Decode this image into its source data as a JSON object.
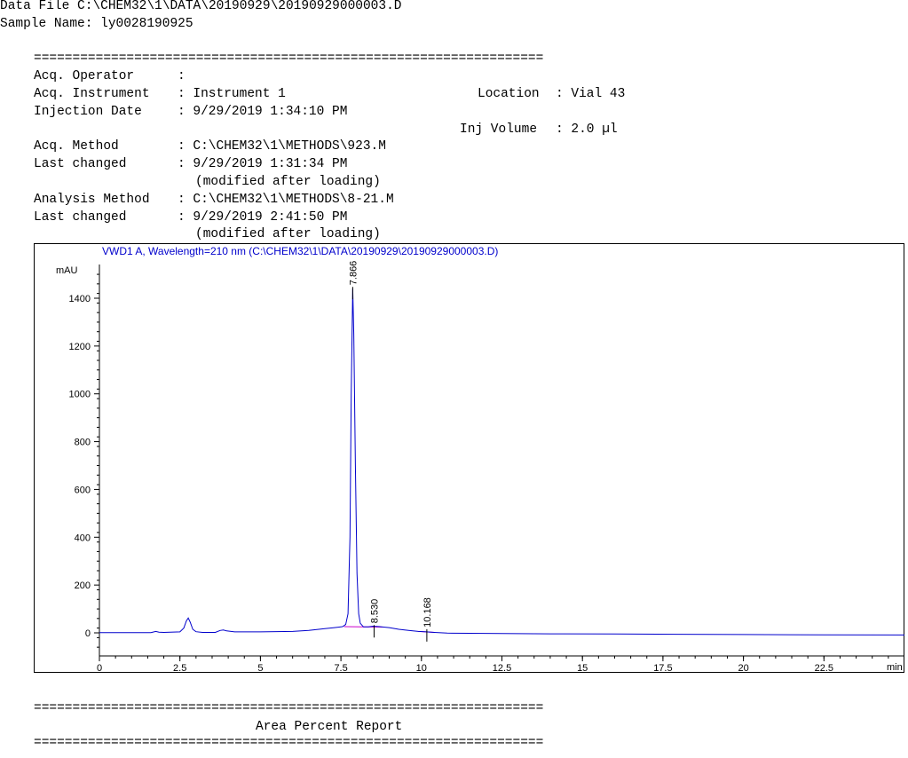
{
  "header": {
    "data_file_label": "Data File",
    "data_file_path": "C:\\CHEM32\\1\\DATA\\20190929\\20190929000003.D",
    "sample_name_label": "Sample Name:",
    "sample_name": "ly0028190925"
  },
  "separator": "==================================================================",
  "info": {
    "acq_operator_label": "Acq. Operator",
    "acq_operator_value": ":",
    "acq_instrument_label": "Acq. Instrument",
    "acq_instrument_value": ": Instrument 1",
    "location_label": "Location",
    "location_value": ": Vial 43",
    "injection_date_label": "Injection Date",
    "injection_date_value": ": 9/29/2019 1:34:10 PM",
    "inj_volume_label": "Inj Volume",
    "inj_volume_value": ": 2.0 µl",
    "acq_method_label": "Acq. Method",
    "acq_method_value": ": C:\\CHEM32\\1\\METHODS\\923.M",
    "last_changed_1_label": "Last changed",
    "last_changed_1_value": ": 9/29/2019 1:31:34 PM",
    "modified_1": "(modified after loading)",
    "analysis_method_label": "Analysis Method",
    "analysis_method_value": ": C:\\CHEM32\\1\\METHODS\\8-21.M",
    "last_changed_2_label": "Last changed",
    "last_changed_2_value": ": 9/29/2019 2:41:50 PM",
    "modified_2": "(modified after loading)"
  },
  "report_title": "Area Percent Report",
  "chart_data": {
    "type": "line",
    "title": "VWD1 A, Wavelength=210 nm (C:\\CHEM32\\1\\DATA\\20190929\\20190929000003.D)",
    "ylabel": "mAU",
    "xlabel": "min",
    "xlim": [
      0,
      25
    ],
    "ylim": [
      -150,
      1530
    ],
    "x_ticks": [
      0,
      2.5,
      5,
      7.5,
      10,
      12.5,
      15,
      17.5,
      20,
      22.5
    ],
    "x_tick_labels": [
      "0",
      "2.5",
      "5",
      "7.5",
      "10",
      "12.5",
      "15",
      "17.5",
      "20",
      "22.5"
    ],
    "y_ticks": [
      0,
      200,
      400,
      600,
      800,
      1000,
      1200,
      1400
    ],
    "y_tick_labels": [
      "0",
      "200",
      "400",
      "600",
      "800",
      "1000",
      "1200",
      "1400"
    ],
    "grid": false,
    "line_color": "#0000cc",
    "baseline_color": "#cc00cc",
    "peak_labels": [
      {
        "x": 7.866,
        "label": "7.866",
        "y": 1440
      },
      {
        "x": 8.53,
        "label": "8.530",
        "y": 25
      },
      {
        "x": 10.168,
        "label": "10.168",
        "y": 8
      }
    ],
    "series": [
      {
        "x": [
          0,
          1.6,
          1.75,
          1.85,
          2.0,
          2.5,
          2.62,
          2.7,
          2.76,
          2.82,
          2.9,
          3.0,
          3.2,
          3.6,
          3.75,
          3.85,
          3.95,
          4.2,
          5,
          6,
          6.5,
          7.0,
          7.3,
          7.55,
          7.65,
          7.72,
          7.78,
          7.82,
          7.866,
          7.9,
          7.95,
          8.0,
          8.05,
          8.1,
          8.2,
          8.35,
          8.5,
          8.7,
          9.0,
          9.3,
          9.6,
          9.9,
          10.168,
          10.4,
          10.8,
          11.5,
          12.5,
          14,
          16,
          18,
          20,
          22.5,
          25
        ],
        "y": [
          1,
          1,
          6,
          3,
          2,
          4,
          20,
          50,
          62,
          45,
          15,
          5,
          2,
          2,
          10,
          12,
          8,
          4,
          4,
          6,
          10,
          18,
          22,
          26,
          35,
          80,
          400,
          1000,
          1440,
          1250,
          700,
          250,
          80,
          40,
          25,
          25,
          28,
          26,
          22,
          15,
          10,
          6,
          4,
          2,
          -1,
          -2,
          -3,
          -4,
          -5,
          -6,
          -7,
          -8,
          -9
        ]
      }
    ]
  }
}
